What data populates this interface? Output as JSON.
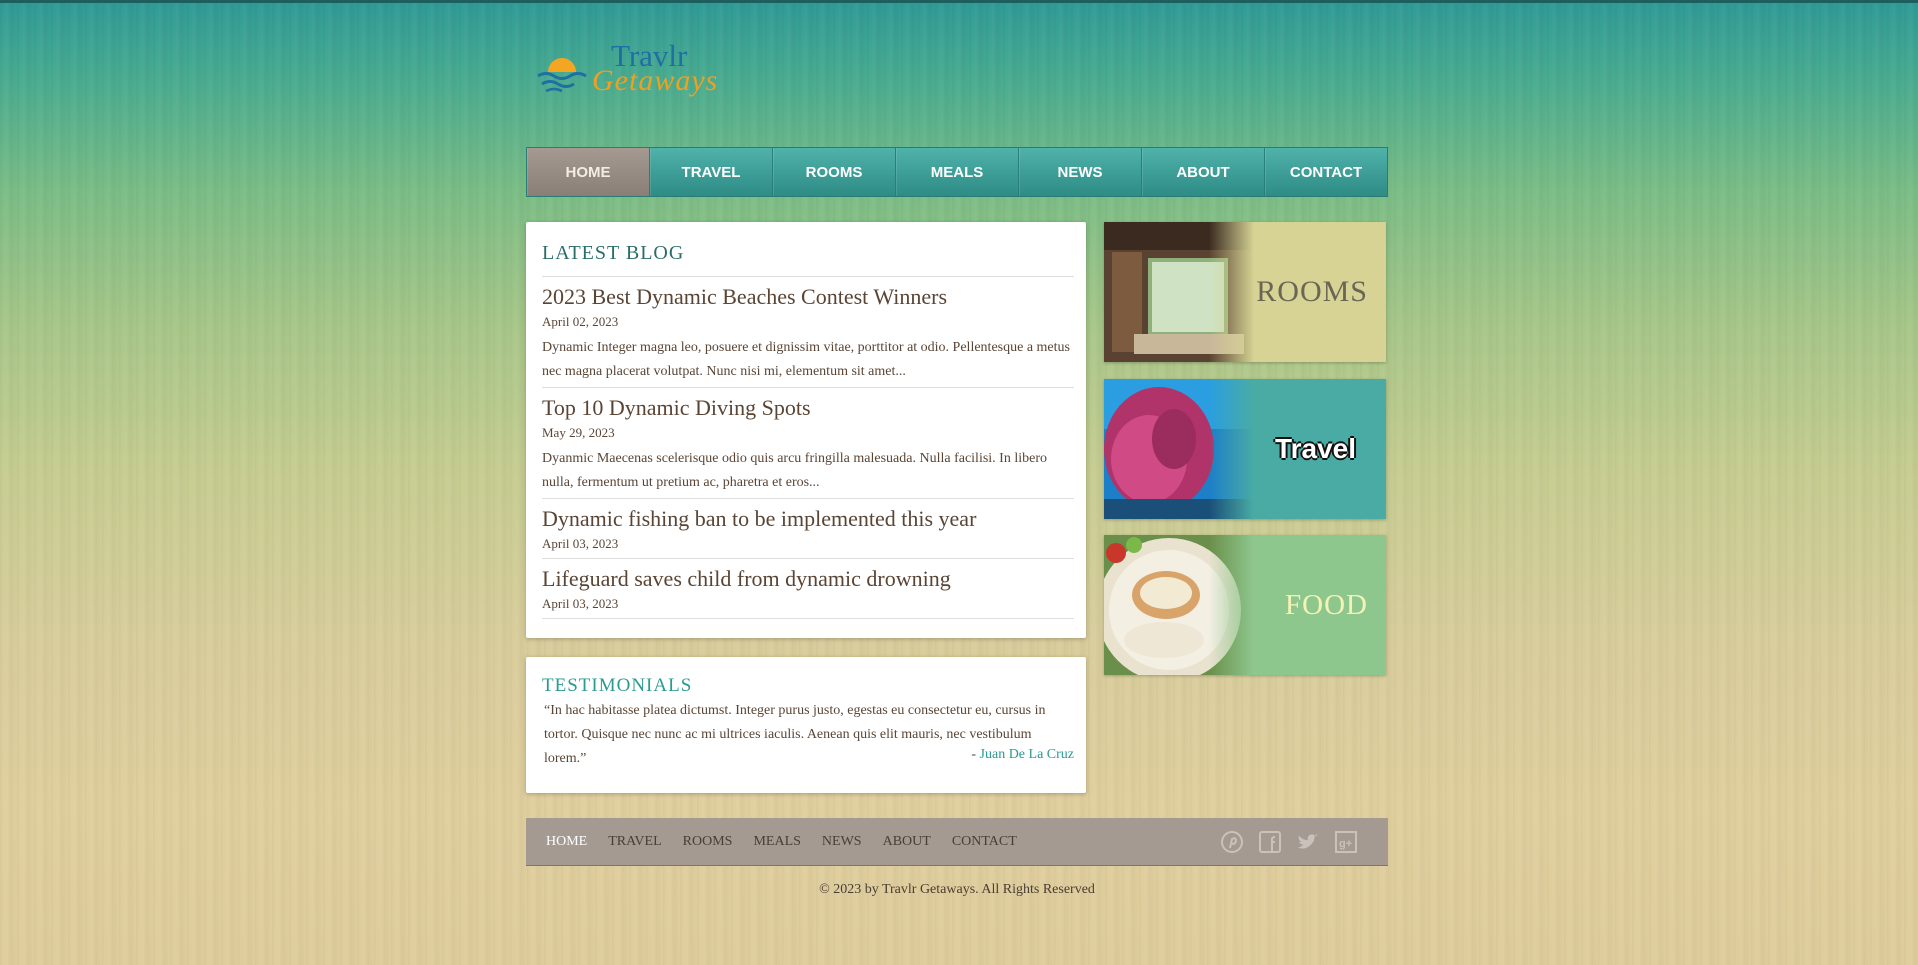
{
  "brand": {
    "name_line1": "Travlr",
    "name_line2": "Getaways"
  },
  "nav": {
    "items": [
      {
        "label": "HOME",
        "active": true
      },
      {
        "label": "TRAVEL"
      },
      {
        "label": "ROOMS"
      },
      {
        "label": "MEALS"
      },
      {
        "label": "NEWS"
      },
      {
        "label": "ABOUT"
      },
      {
        "label": "CONTACT"
      }
    ]
  },
  "blog": {
    "heading": "LATEST BLOG",
    "posts": [
      {
        "title": "2023 Best Dynamic Beaches Contest Winners",
        "date": "April 02, 2023",
        "excerpt": "Dynamic Integer magna leo, posuere et dignissim vitae, porttitor at odio. Pellentesque a metus nec magna placerat volutpat. Nunc nisi mi, elementum sit amet..."
      },
      {
        "title": "Top 10 Dynamic Diving Spots",
        "date": "May 29, 2023",
        "excerpt": "Dyanmic Maecenas scelerisque odio quis arcu fringilla malesuada. Nulla facilisi. In libero nulla, fermentum ut pretium ac, pharetra et eros..."
      },
      {
        "title": "Dynamic fishing ban to be implemented this year",
        "date": "April 03, 2023"
      },
      {
        "title": "Lifeguard saves child from dynamic drowning",
        "date": "April 03, 2023"
      }
    ]
  },
  "testimonials": {
    "heading": "TESTIMONIALS",
    "quote": "“In hac habitasse platea dictumst. Integer purus justo, egestas eu consectetur eu, cursus in tortor. Quisque nec nunc ac mi ultrices iaculis. Aenean quis elit mauris, nec vestibulum lorem.”",
    "author_prefix": "- ",
    "author": "Juan De La Cruz"
  },
  "features": {
    "rooms": "ROOMS",
    "travel": "Travel",
    "food": "FOOD"
  },
  "footer": {
    "links": [
      {
        "label": "HOME",
        "active": true
      },
      {
        "label": "TRAVEL"
      },
      {
        "label": "ROOMS"
      },
      {
        "label": "MEALS"
      },
      {
        "label": "NEWS"
      },
      {
        "label": "ABOUT"
      },
      {
        "label": "CONTACT"
      }
    ],
    "social_icons": [
      "pinterest-icon",
      "facebook-icon",
      "twitter-icon",
      "google-plus-icon"
    ],
    "copyright": "© 2023 by Travlr Getaways. All Rights Reserved"
  },
  "colors": {
    "nav_teal": "#3a9e97",
    "nav_active": "#958a82",
    "heading_teal": "#2a6e6a",
    "text_brown": "#5a4535",
    "rooms_bg": "#d6d394",
    "travel_bg": "#4aaba4",
    "food_bg": "#8ec78e",
    "footer_bg": "#a49a92"
  }
}
